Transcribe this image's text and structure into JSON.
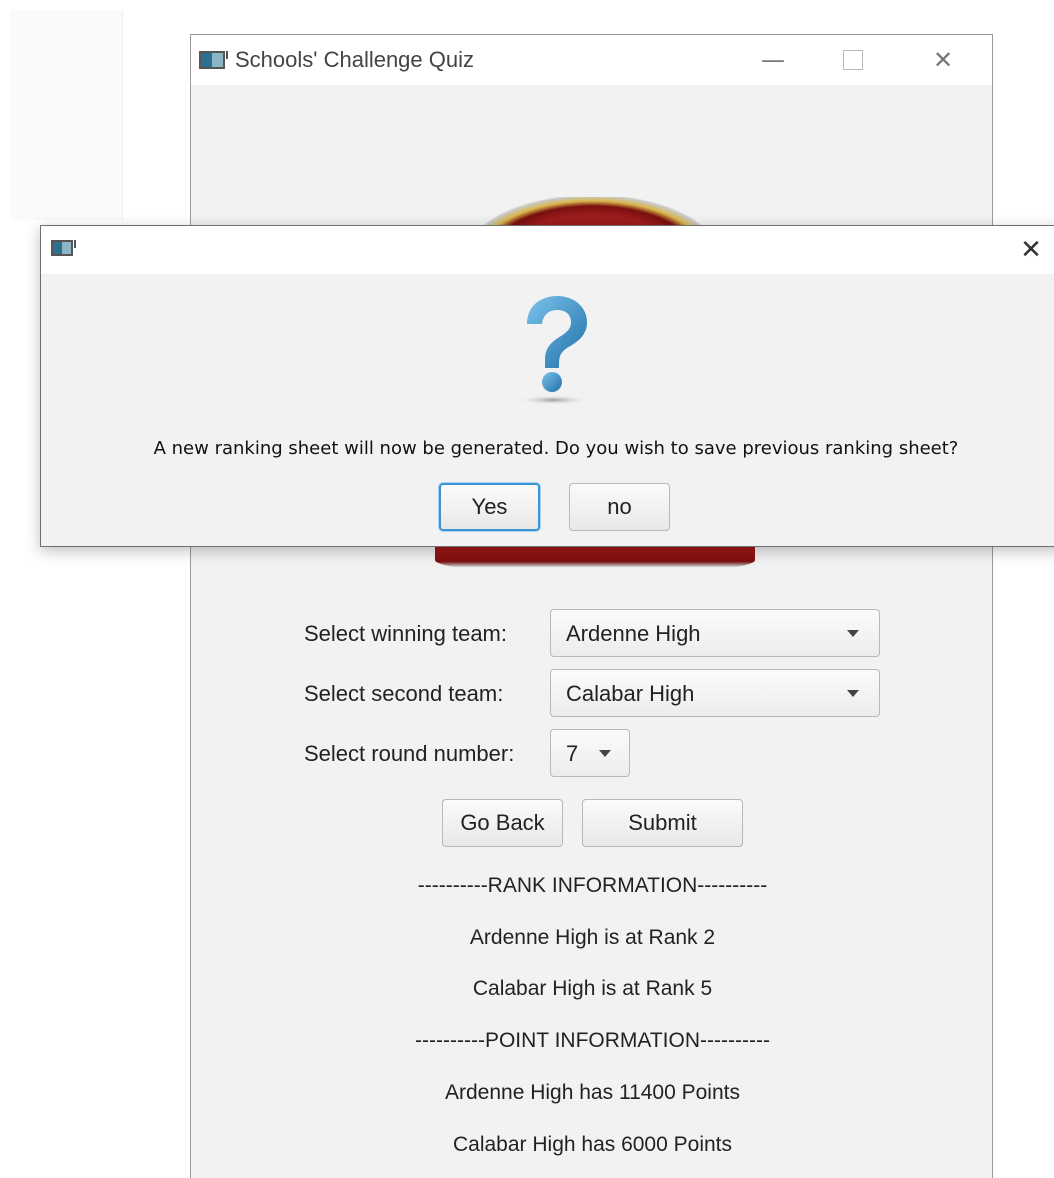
{
  "main_window": {
    "title": "Schools' Challenge Quiz",
    "controls": {
      "minimize": "—",
      "close": "✕"
    }
  },
  "form": {
    "winning_label": "Select winning team:",
    "winning_value": "Ardenne High",
    "second_label": "Select second team:",
    "second_value": "Calabar High",
    "round_label": "Select round number:",
    "round_value": "7",
    "go_back_label": "Go Back",
    "submit_label": "Submit"
  },
  "info": {
    "rank_header": "----------RANK INFORMATION----------",
    "rank_line_1": "Ardenne High is at Rank 2",
    "rank_line_2": "Calabar High is at Rank 5",
    "point_header": "----------POINT INFORMATION----------",
    "point_line_1": "Ardenne High has 11400 Points",
    "point_line_2": "Calabar High has 6000 Points"
  },
  "dialog": {
    "title": "",
    "close": "✕",
    "icon": "question-icon",
    "message": "A new ranking sheet will now be generated. Do you wish to save previous ranking sheet?",
    "yes_label": "Yes",
    "no_label": "no"
  },
  "colors": {
    "window_bg": "#f2f2f2",
    "focus_accent": "#3a95d4",
    "question_blue": "#2f8fcf"
  }
}
